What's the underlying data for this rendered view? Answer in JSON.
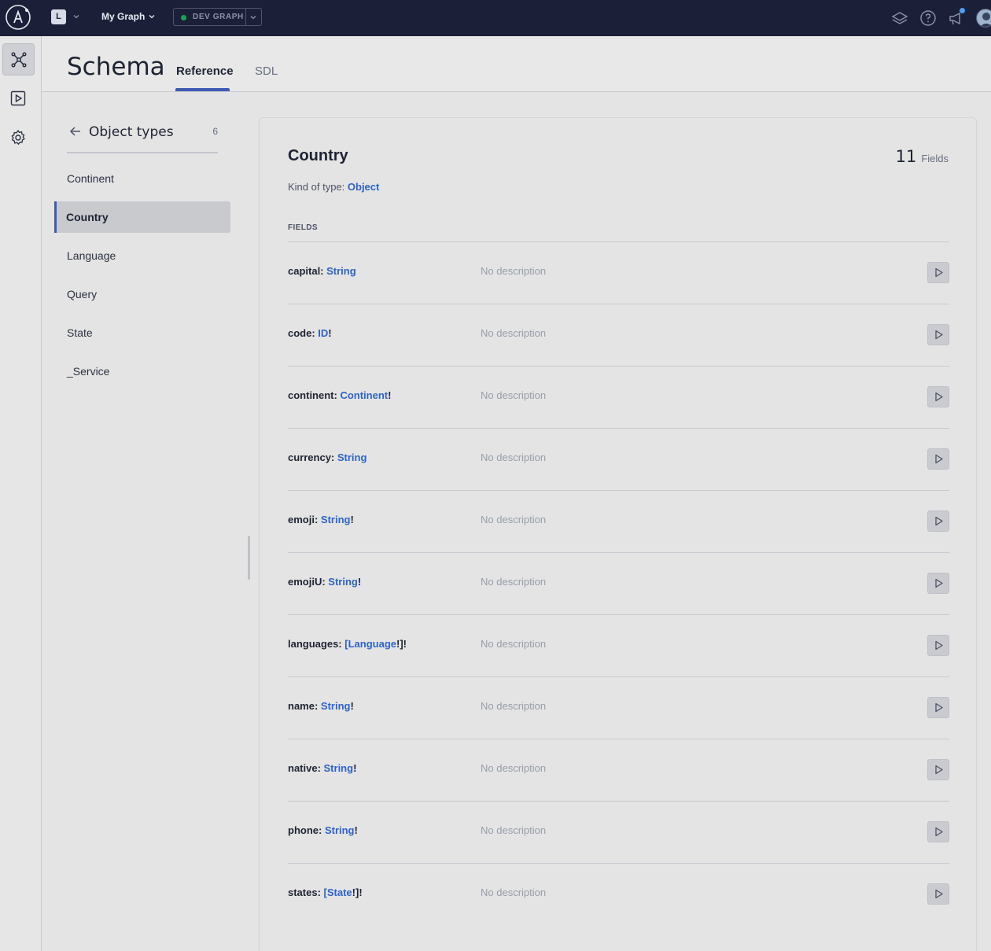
{
  "topbar": {
    "org_initial": "L",
    "graph_name": "My Graph",
    "variant_label": "DEV GRAPH",
    "variant_status_color": "#1fa05a"
  },
  "sidenav": {
    "items": [
      {
        "icon": "graph-icon",
        "active": true
      },
      {
        "icon": "play-square-icon",
        "active": false
      },
      {
        "icon": "gear-icon",
        "active": false
      }
    ]
  },
  "header": {
    "title": "Schema",
    "tabs": [
      {
        "label": "Reference",
        "active": true
      },
      {
        "label": "SDL",
        "active": false
      }
    ]
  },
  "typelist": {
    "title": "Object types",
    "count": "6",
    "items": [
      {
        "label": "Continent",
        "active": false
      },
      {
        "label": "Country",
        "active": true
      },
      {
        "label": "Language",
        "active": false
      },
      {
        "label": "Query",
        "active": false
      },
      {
        "label": "State",
        "active": false
      },
      {
        "label": "_Service",
        "active": false
      }
    ]
  },
  "detail": {
    "type_name": "Country",
    "fields_count": "11",
    "fields_count_label": "Fields",
    "kind_label": "Kind of type: ",
    "kind_value": "Object",
    "fields_heading": "FIELDS",
    "fields": [
      {
        "name": "capital: ",
        "prefix": "",
        "type": "String",
        "suffix": "",
        "description": "No description"
      },
      {
        "name": "code: ",
        "prefix": "",
        "type": "ID",
        "suffix": "!",
        "description": "No description"
      },
      {
        "name": "continent: ",
        "prefix": "",
        "type": "Continent",
        "suffix": "!",
        "description": "No description"
      },
      {
        "name": "currency: ",
        "prefix": "",
        "type": "String",
        "suffix": "",
        "description": "No description"
      },
      {
        "name": "emoji: ",
        "prefix": "",
        "type": "String",
        "suffix": "!",
        "description": "No description"
      },
      {
        "name": "emojiU: ",
        "prefix": "",
        "type": "String",
        "suffix": "!",
        "description": "No description"
      },
      {
        "name": "languages: ",
        "prefix": "[",
        "type": "Language",
        "suffix": "!]!",
        "description": "No description"
      },
      {
        "name": "name: ",
        "prefix": "",
        "type": "String",
        "suffix": "!",
        "description": "No description"
      },
      {
        "name": "native: ",
        "prefix": "",
        "type": "String",
        "suffix": "!",
        "description": "No description"
      },
      {
        "name": "phone: ",
        "prefix": "",
        "type": "String",
        "suffix": "!",
        "description": "No description"
      },
      {
        "name": "states: ",
        "prefix": "[",
        "type": "State",
        "suffix": "!]!",
        "description": "No description"
      }
    ]
  }
}
